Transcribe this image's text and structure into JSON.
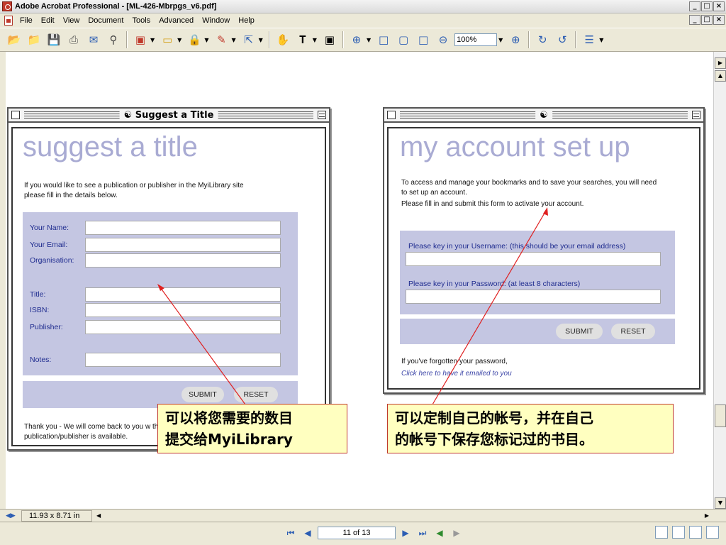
{
  "window": {
    "title": "Adobe Acrobat Professional - [ML-426-Mbrpgs_v6.pdf]",
    "controls": [
      "_",
      "□",
      "×"
    ]
  },
  "menu": {
    "items": [
      "File",
      "Edit",
      "View",
      "Document",
      "Tools",
      "Advanced",
      "Window",
      "Help"
    ]
  },
  "toolbar": {
    "zoom": "100%"
  },
  "doc": {
    "left_window": {
      "title": "Suggest a Title",
      "heading": "suggest a title",
      "intro": "If you would like to see a publication or publisher in the MyiLibrary site please fill in the details below.",
      "labels": [
        "Your Name:",
        "Your Email:",
        "Organisation:",
        "Title:",
        "ISBN:",
        "Publisher:",
        "Notes:"
      ],
      "submit": "SUBMIT",
      "reset": "RESET",
      "thanks": "Thank you - We will come back to you w this publication/publisher is available."
    },
    "right_window": {
      "heading": "my account set up",
      "intro": "To access and manage your bookmarks and to save your searches, you will need to set up an account.",
      "intro2": "Please fill in and submit this form to activate your account.",
      "username_label": "Please key in your Username: (this should be your email address)",
      "password_label": "Please key in your Password: (at least 8 characters)",
      "submit": "SUBMIT",
      "reset": "RESET",
      "forgot": "If you've forgotten your password,",
      "forgot_link": "Click here to have it emailed to you"
    },
    "callout_left": {
      "line1": "可以将您需要的数目",
      "line2": "提交给MyiLibrary"
    },
    "callout_right": {
      "line1": "可以定制自己的帐号，并在自己",
      "line2": "的帐号下保存您标记过的书目。"
    }
  },
  "hscroll": {
    "page_size": "11.93 x 8.71 in"
  },
  "status": {
    "page": "11 of 13"
  }
}
